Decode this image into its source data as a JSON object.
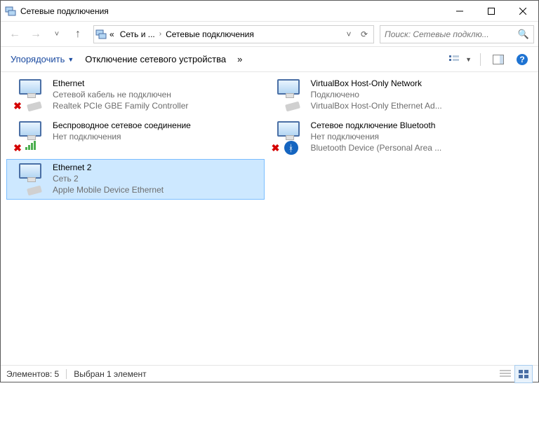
{
  "title": "Сетевые подключения",
  "breadcrumb": {
    "prefix": "«",
    "part1": "Сеть и ...",
    "part2": "Сетевые подключения",
    "sep": "›"
  },
  "search": {
    "placeholder": "Поиск: Сетевые подклю..."
  },
  "toolbar": {
    "organize": "Упорядочить",
    "disconnect": "Отключение сетевого устройства",
    "more": "»"
  },
  "connections": [
    {
      "name": "Ethernet",
      "status": "Сетевой кабель не подключен",
      "device": "Realtek PCIe GBE Family Controller",
      "icon_type": "cable",
      "disconnected": true,
      "selected": false
    },
    {
      "name": "VirtualBox Host-Only Network",
      "status": "Подключено",
      "device": "VirtualBox Host-Only Ethernet Ad...",
      "icon_type": "cable",
      "disconnected": false,
      "selected": false
    },
    {
      "name": "Беспроводное сетевое соединение",
      "status": "Нет подключения",
      "device": "",
      "icon_type": "wifi",
      "disconnected": true,
      "selected": false
    },
    {
      "name": "Сетевое подключение Bluetooth",
      "status": "Нет подключения",
      "device": "Bluetooth Device (Personal Area ...",
      "icon_type": "bt",
      "disconnected": true,
      "selected": false
    },
    {
      "name": "Ethernet 2",
      "status": "Сеть 2",
      "device": "Apple Mobile Device Ethernet",
      "icon_type": "cable",
      "disconnected": false,
      "selected": true
    }
  ],
  "statusbar": {
    "items": "Элементов: 5",
    "selected": "Выбран 1 элемент"
  }
}
